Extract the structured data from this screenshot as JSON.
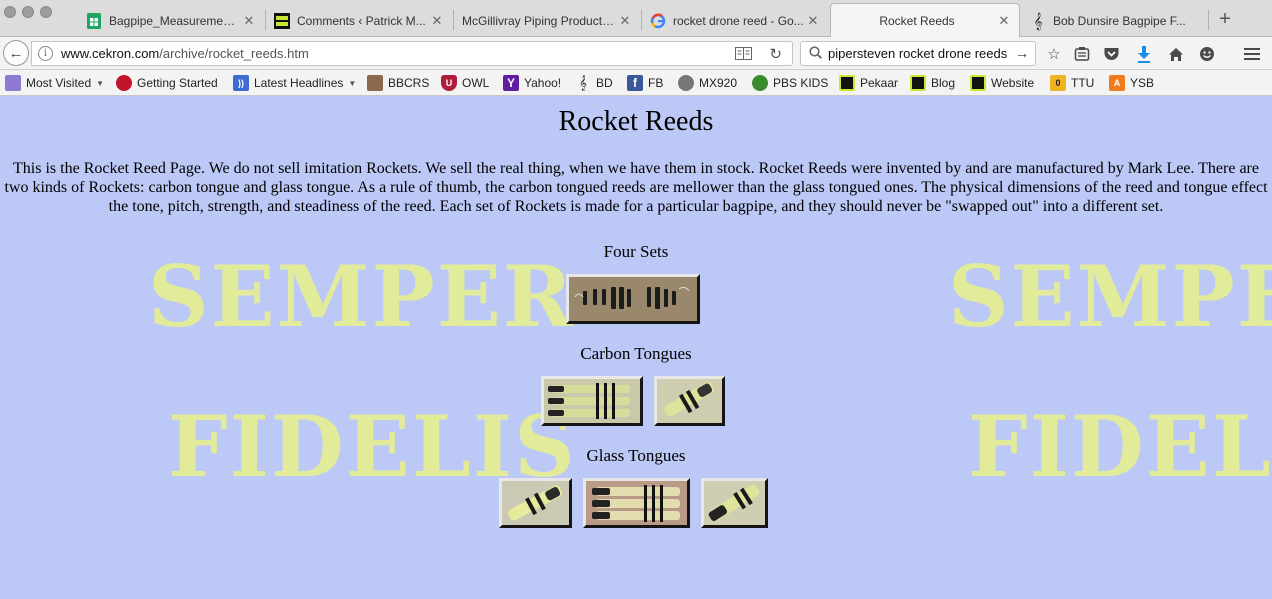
{
  "browser": {
    "tabs": [
      {
        "title": "Bagpipe_Measurement...",
        "icon": "sheets-icon"
      },
      {
        "title": "Comments ‹ Patrick M...",
        "icon": "site-logo-icon"
      },
      {
        "title": "McGillivray Piping Products...",
        "icon": "blank-page-icon"
      },
      {
        "title": "rocket drone reed - Go...",
        "icon": "google-icon"
      },
      {
        "title": "Rocket Reeds",
        "icon": "none"
      },
      {
        "title": "Bob Dunsire Bagpipe F...",
        "icon": "treble-clef-icon"
      }
    ],
    "active_tab": 4,
    "url_host": "www.cekron.com",
    "url_path": "/archive/rocket_reeds.htm",
    "search_value": "pipersteven rocket drone reeds"
  },
  "bookmarks": [
    {
      "label": "Most Visited",
      "icon": "folder-icon",
      "dropdown": true
    },
    {
      "label": "Getting Started",
      "icon": "firefox-icon"
    },
    {
      "label": "Latest Headlines",
      "icon": "rss-icon",
      "dropdown": true
    },
    {
      "label": "BBCRS",
      "icon": "portrait-icon"
    },
    {
      "label": "OWL",
      "icon": "shield-icon"
    },
    {
      "label": "Yahoo!",
      "icon": "yahoo-icon"
    },
    {
      "label": "BD",
      "icon": "treble-clef-icon"
    },
    {
      "label": "FB",
      "icon": "facebook-icon"
    },
    {
      "label": "MX920",
      "icon": "globe-icon"
    },
    {
      "label": "PBS KIDS",
      "icon": "pbs-kids-icon"
    },
    {
      "label": "Pekaar",
      "icon": "site-logo-icon"
    },
    {
      "label": "Blog",
      "icon": "site-logo-icon"
    },
    {
      "label": "Website",
      "icon": "site-logo-icon"
    },
    {
      "label": "TTU",
      "icon": "ttu-icon"
    },
    {
      "label": "YSB",
      "icon": "ysb-icon"
    }
  ],
  "page": {
    "title": "Rocket Reeds",
    "intro": "This is the Rocket Reed Page. We do not sell imitation Rockets. We sell the real thing, when we have them in stock. Rocket Reeds were invented by and are manufactured by Mark Lee. There are two kinds of Rockets: carbon tongue and glass tongue. As a rule of thumb, the carbon tongued reeds are mellower than the glass tongued ones. The physical dimensions of the reed and tongue effect the tone, pitch, strength, and steadiness of the reed. Each set of Rockets is made for a particular bagpipe, and they should never be \"swapped out\" into a different set.",
    "sections": [
      {
        "title": "Four Sets",
        "images": 1
      },
      {
        "title": "Carbon Tongues",
        "images": 2
      },
      {
        "title": "Glass Tongues",
        "images": 3
      }
    ],
    "watermark": {
      "line1": "SEMPER",
      "line2": "FIDELIS"
    }
  },
  "colors": {
    "page_background": "#bcc8f6",
    "watermark": "#e2eb9a"
  }
}
